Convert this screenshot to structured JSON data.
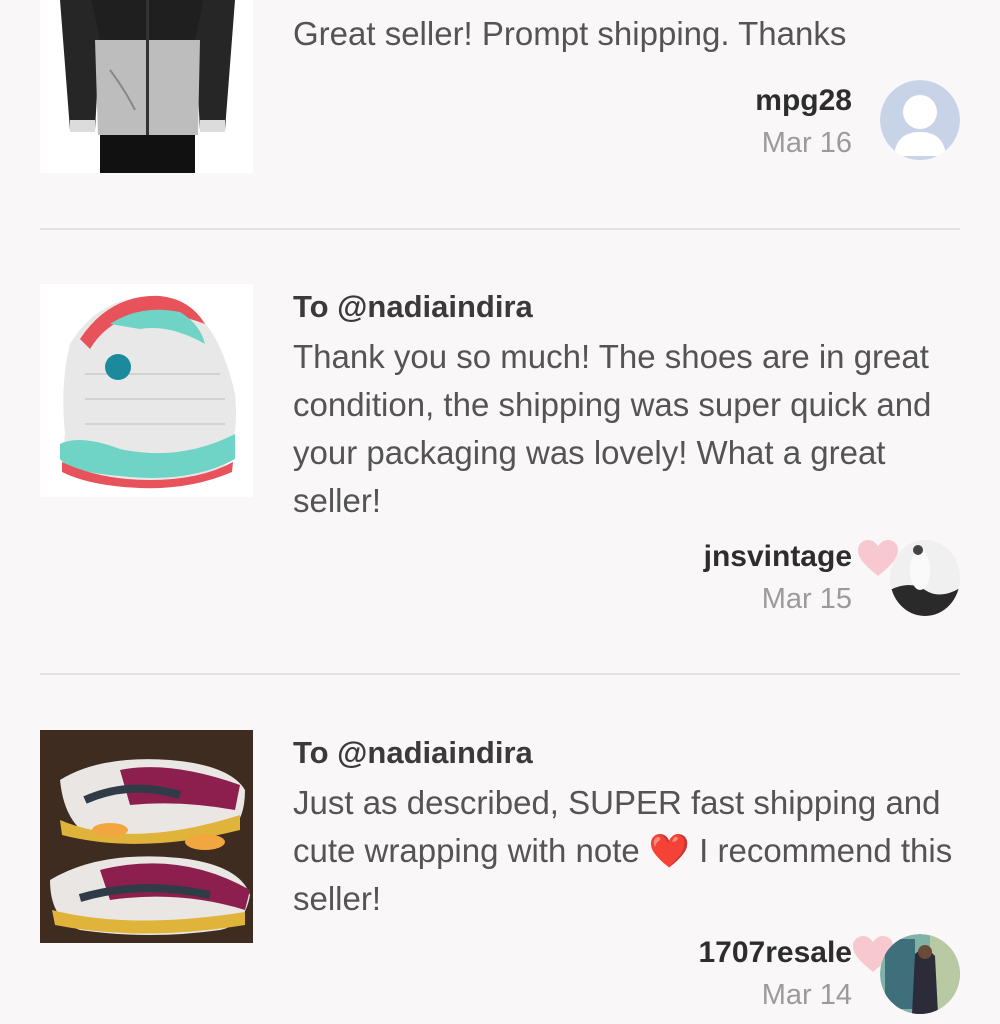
{
  "reviews": [
    {
      "to": "",
      "text": "Great seller! Prompt shipping. Thanks",
      "username": "mpg28",
      "date": "Mar 16"
    },
    {
      "to": "To @nadiaindira",
      "text": "Thank you so much! The shoes are in great condition, the shipping was super quick and your packaging was lovely! What a great seller!",
      "username": "jnsvintage",
      "date": "Mar 15"
    },
    {
      "to": "To @nadiaindira",
      "text": "Just as described, SUPER fast shipping and cute wrapping with note ❤️ I recommend this seller!",
      "username": "1707resale",
      "date": "Mar 14"
    }
  ],
  "colors": {
    "heart": "#f7c8cf",
    "divider": "#e4e2e3",
    "background": "#f9f7f8"
  }
}
